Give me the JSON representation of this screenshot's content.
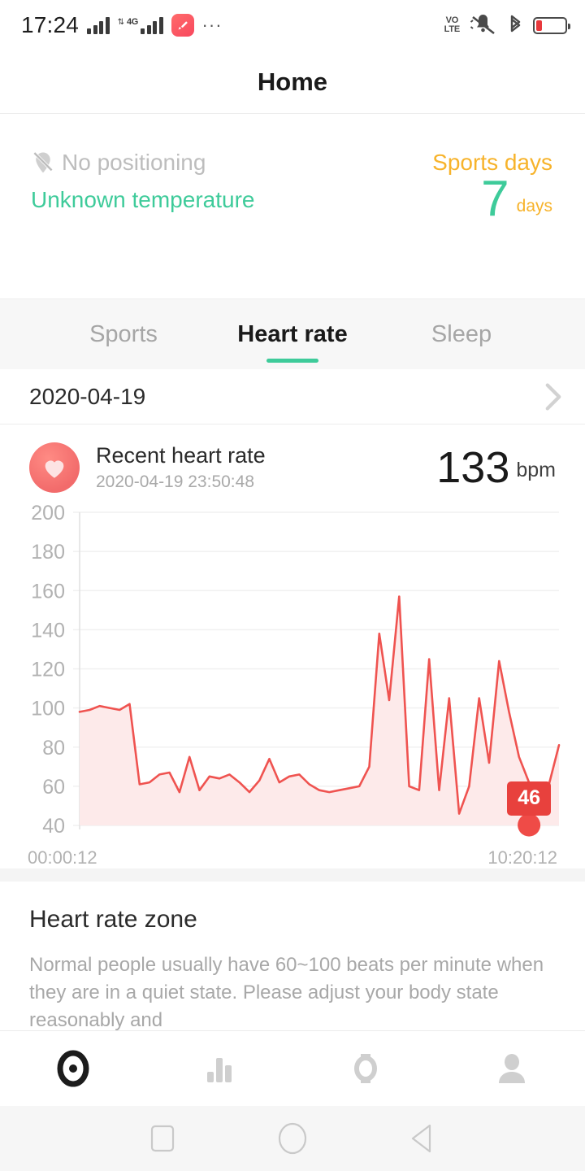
{
  "status_bar": {
    "time": "17:24",
    "network_label": "4G",
    "volte_line1": "VO",
    "volte_line2": "LTE",
    "icons": [
      "signal-bars-icon",
      "signal-bars-4g-icon",
      "app-badge-icon",
      "overflow-dots-icon",
      "volte-icon",
      "mute-bell-icon",
      "bluetooth-icon",
      "battery-low-icon"
    ]
  },
  "header": {
    "title": "Home"
  },
  "summary": {
    "positioning": "No positioning",
    "temperature": "Unknown temperature",
    "sports_days_label": "Sports days",
    "sports_days_value": "7",
    "sports_days_unit": "days"
  },
  "tabs": [
    {
      "label": "Sports",
      "active": false
    },
    {
      "label": "Heart rate",
      "active": true
    },
    {
      "label": "Sleep",
      "active": false
    }
  ],
  "date_row": {
    "date": "2020-04-19"
  },
  "heart_rate_card": {
    "title": "Recent heart rate",
    "timestamp": "2020-04-19 23:50:48",
    "value": "133",
    "unit": "bpm",
    "tooltip_value": "46"
  },
  "zone": {
    "title": "Heart rate zone",
    "description": "Normal people usually have 60~100 beats per minute when they are in a quiet state. Please adjust your body state reasonably and"
  },
  "bottom_nav": [
    {
      "name": "home",
      "active": true
    },
    {
      "name": "statistics",
      "active": false
    },
    {
      "name": "device",
      "active": false
    },
    {
      "name": "profile",
      "active": false
    }
  ],
  "system_nav": [
    "recents-square-icon",
    "home-circle-icon",
    "back-triangle-icon"
  ],
  "colors": {
    "accent_green": "#3ecb9a",
    "accent_orange": "#f7b32b",
    "heart_red": "#e8413d",
    "line_red": "#ef5350",
    "muted_gray": "#a8a8a8"
  },
  "chart_data": {
    "type": "line",
    "title": "Recent heart rate",
    "xlabel": "",
    "ylabel": "bpm",
    "ylim": [
      40,
      200
    ],
    "yticks": [
      200,
      180,
      160,
      140,
      120,
      100,
      80,
      60,
      40
    ],
    "grid": true,
    "legend": false,
    "x_tick_labels": [
      "00:00:12",
      "10:20:12"
    ],
    "x_range": [
      "00:00:12",
      "10:20:12"
    ],
    "area_fill": true,
    "annotations": [
      {
        "label": "46",
        "value": 46,
        "index": 45,
        "marker": "circle"
      }
    ],
    "series": [
      {
        "name": "Heart rate",
        "color": "#ef5350",
        "values": [
          98,
          99,
          101,
          100,
          99,
          102,
          61,
          62,
          66,
          67,
          57,
          75,
          58,
          65,
          64,
          66,
          62,
          57,
          63,
          74,
          62,
          65,
          66,
          61,
          58,
          57,
          58,
          59,
          60,
          70,
          138,
          104,
          157,
          60,
          58,
          125,
          58,
          105,
          46,
          60,
          105,
          72,
          124,
          98,
          75,
          62,
          58,
          61,
          81
        ]
      }
    ]
  }
}
